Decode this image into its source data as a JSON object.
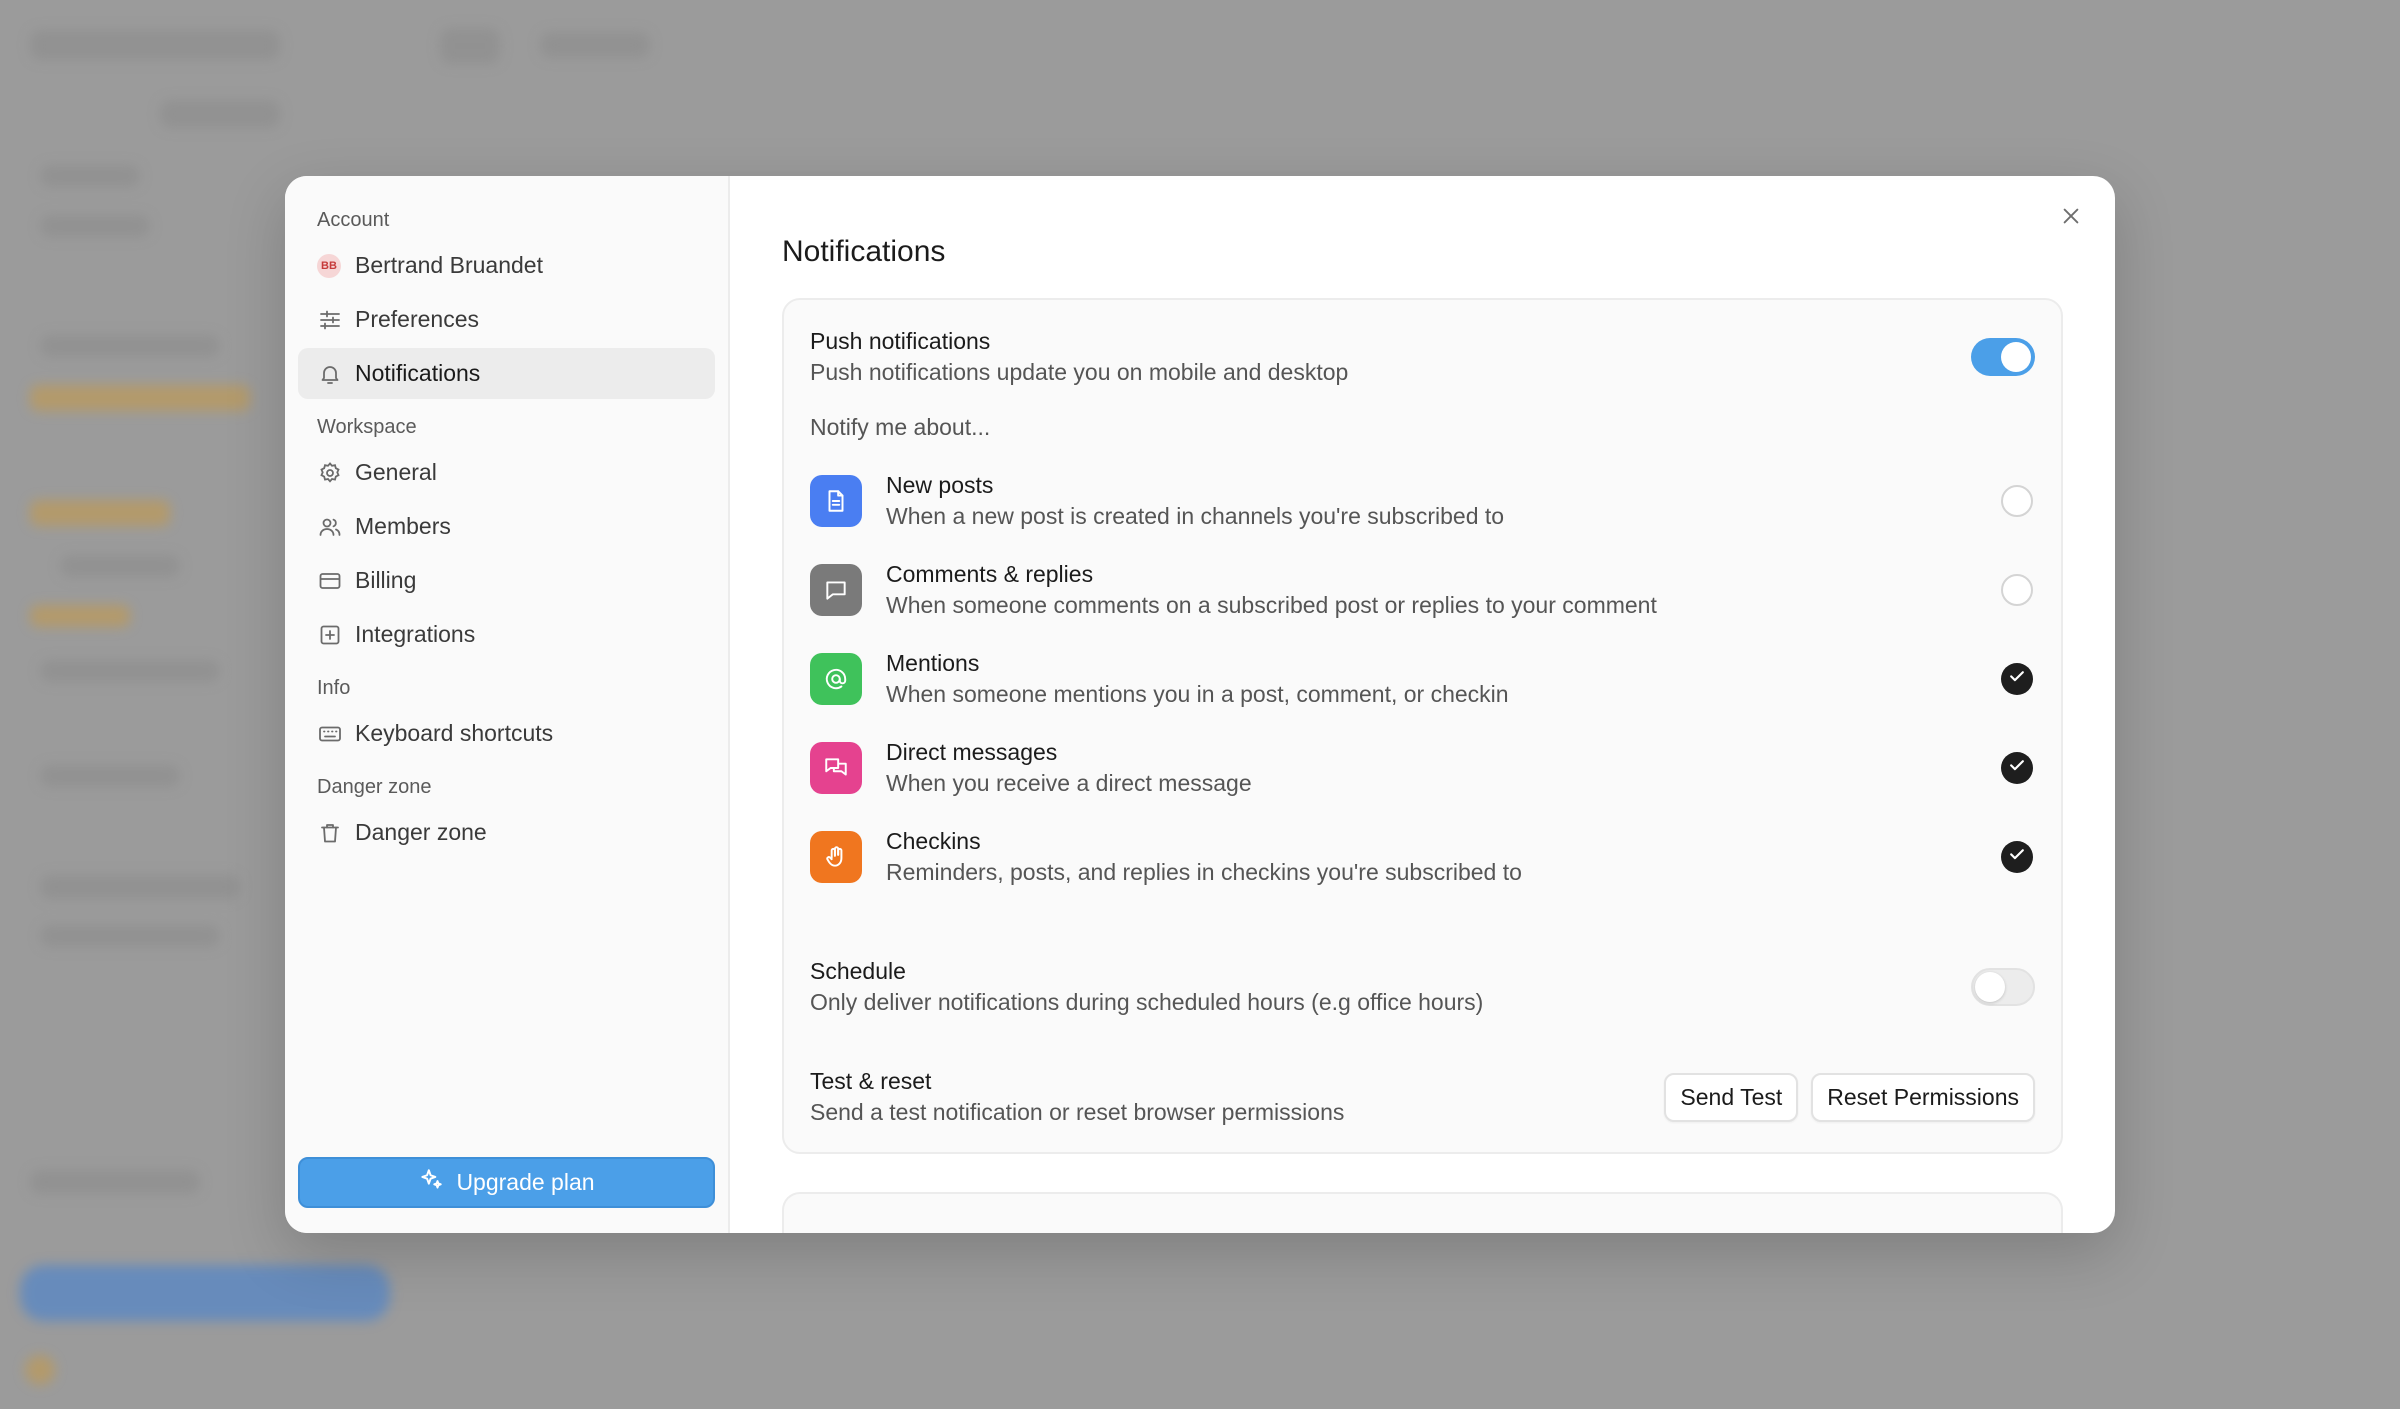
{
  "sidebar": {
    "sections": {
      "account": "Account",
      "workspace": "Workspace",
      "info": "Info",
      "danger": "Danger zone"
    },
    "user": {
      "initials": "BB",
      "name": "Bertrand Bruandet"
    },
    "items": {
      "preferences": "Preferences",
      "notifications": "Notifications",
      "general": "General",
      "members": "Members",
      "billing": "Billing",
      "integrations": "Integrations",
      "keyboard_shortcuts": "Keyboard shortcuts",
      "danger_zone": "Danger zone"
    },
    "active_item": "notifications",
    "upgrade_label": "Upgrade plan"
  },
  "main": {
    "title": "Notifications",
    "push": {
      "title": "Push notifications",
      "description": "Push notifications update you on mobile and desktop",
      "enabled": true
    },
    "notify_label": "Notify me about...",
    "notifications": [
      {
        "icon": "document-icon",
        "color": "#4a7ef2",
        "title": "New posts",
        "description": "When a new post is created in channels you're subscribed to",
        "checked": false
      },
      {
        "icon": "comment-icon",
        "color": "#7a7a7a",
        "title": "Comments & replies",
        "description": "When someone comments on a subscribed post or replies to your comment",
        "checked": false
      },
      {
        "icon": "at-icon",
        "color": "#3fc25b",
        "title": "Mentions",
        "description": "When someone mentions you in a post, comment, or checkin",
        "checked": true
      },
      {
        "icon": "chat-bubbles-icon",
        "color": "#e5428f",
        "title": "Direct messages",
        "description": "When you receive a direct message",
        "checked": true
      },
      {
        "icon": "hand-icon",
        "color": "#f0761f",
        "title": "Checkins",
        "description": "Reminders, posts, and replies in checkins you're subscribed to",
        "checked": true
      }
    ],
    "schedule": {
      "title": "Schedule",
      "description": "Only deliver notifications during scheduled hours (e.g office hours)",
      "enabled": false
    },
    "test_reset": {
      "title": "Test & reset",
      "description": "Send a test notification or reset browser permissions",
      "send_test_label": "Send Test",
      "reset_label": "Reset Permissions"
    }
  }
}
